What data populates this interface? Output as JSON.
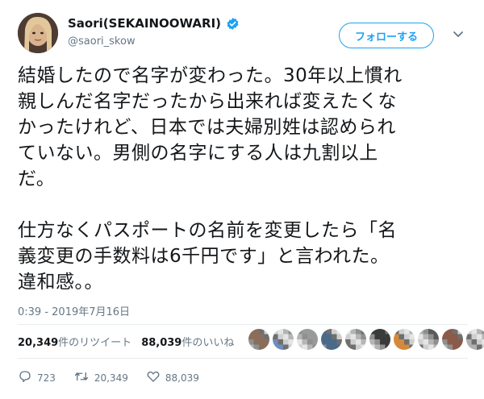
{
  "user": {
    "display_name": "Saori(SEKAINOOWARI)",
    "handle": "@saori_skow",
    "verified": true,
    "follow_label": "フォローする"
  },
  "tweet": {
    "text": "結婚したので名字が変わった。30年以上慣れ\n親しんだ名字だったから出来れば変えたくな\nかったけれど、日本では夫婦別姓は認められ\nていない。男側の名字にする人は九割以上\nだ。\n\n仕方なくパスポートの名前を変更したら「名\n義変更の手数料は6千円です」と言われた。\n違和感。。",
    "timestamp": "0:39 - 2019年7月16日"
  },
  "stats": {
    "retweets_count": "20,349",
    "retweets_label": "件のリツイート",
    "likes_count": "88,039",
    "likes_label": "件のいいね"
  },
  "liker_avatars": [
    {
      "color": "#8a6d5a"
    },
    {
      "color": "#6e8cbf"
    },
    {
      "color": "#9a9a9a"
    },
    {
      "color": "#4a6a8a"
    },
    {
      "color": "#707070"
    },
    {
      "color": "#3a3a3a"
    },
    {
      "color": "#d48a3a"
    },
    {
      "color": "#5a5a5a"
    },
    {
      "color": "#8a5a4a"
    },
    {
      "color": "#b0b0b0"
    }
  ],
  "actions": {
    "reply_count": "723",
    "retweet_count": "20,349",
    "like_count": "88,039"
  },
  "colors": {
    "accent": "#1da1f2",
    "text": "#14171a",
    "muted": "#657786"
  }
}
